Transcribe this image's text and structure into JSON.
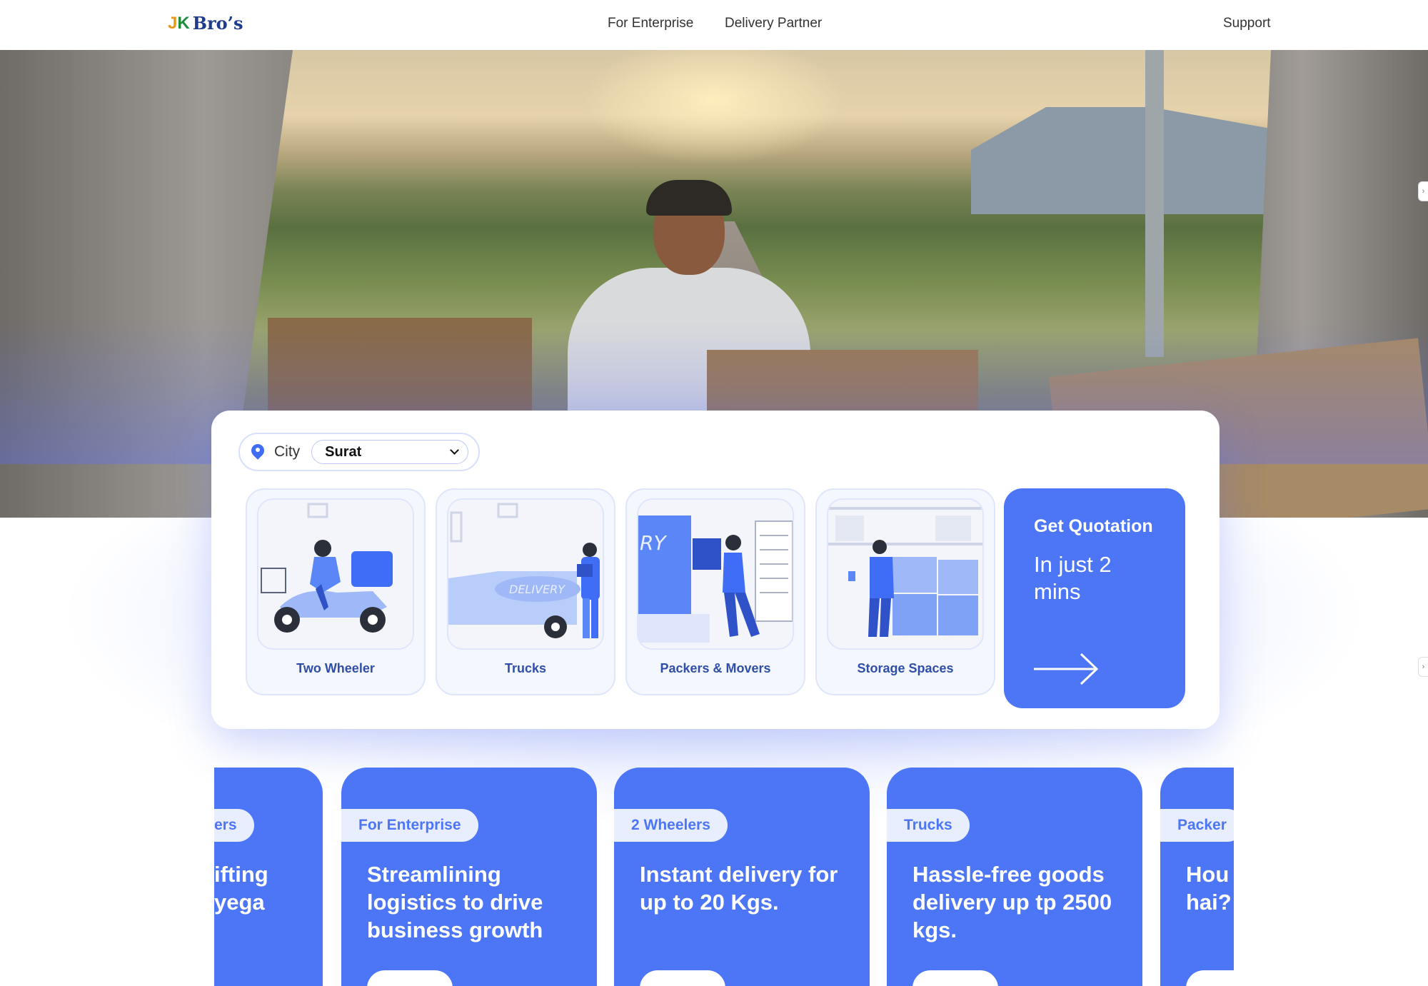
{
  "header": {
    "logo_j": "J",
    "logo_k": "K",
    "logo_bros": "Bro’s",
    "nav": {
      "enterprise": "For Enterprise",
      "partner": "Delivery Partner",
      "support": "Support"
    }
  },
  "booking": {
    "city_label": "City",
    "city_value": "Surat",
    "services": [
      {
        "label": "Two Wheeler",
        "icon": "scooter-courier-icon"
      },
      {
        "label": "Trucks",
        "icon": "delivery-truck-icon"
      },
      {
        "label": "Packers & Movers",
        "icon": "packers-movers-icon"
      },
      {
        "label": "Storage Spaces",
        "icon": "storage-warehouse-icon"
      }
    ],
    "quote": {
      "title": "Get Quotation",
      "subtitle": "In just 2 mins"
    }
  },
  "promos": [
    {
      "tag": "ers",
      "title": "ifting\nyega"
    },
    {
      "tag": "For Enterprise",
      "title": "Streamlining logistics to drive business growth"
    },
    {
      "tag": "2 Wheelers",
      "title": "Instant delivery for up to 20 Kgs."
    },
    {
      "tag": "Trucks",
      "title": "Hassle-free goods delivery up tp 2500 kgs."
    },
    {
      "tag": "Packer",
      "title": "Hou\nhai?"
    }
  ],
  "colors": {
    "accent": "#4d76f7",
    "tag_bg": "#e9eefe",
    "service_text": "#2e4ea8"
  }
}
